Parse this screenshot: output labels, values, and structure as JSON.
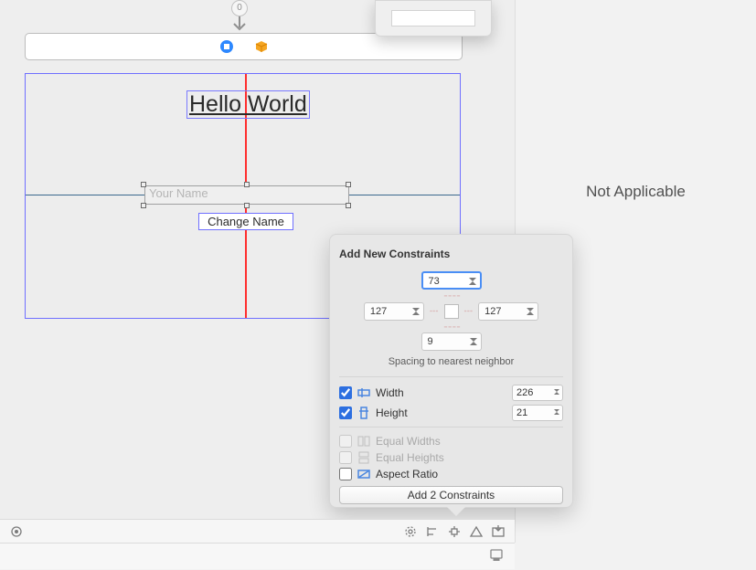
{
  "scene": {
    "label_text": "Hello World",
    "textfield_placeholder": "Your Name",
    "button_label": "Change Name"
  },
  "segue_badge": "0",
  "inspector_placeholder": "Not Applicable",
  "popover": {
    "title": "Add New Constraints",
    "top": "73",
    "leading": "127",
    "trailing": "127",
    "bottom": "9",
    "caption": "Spacing to nearest neighbor",
    "width_label": "Width",
    "width_value": "226",
    "height_label": "Height",
    "height_value": "21",
    "equal_widths": "Equal Widths",
    "equal_heights": "Equal Heights",
    "aspect_ratio": "Aspect Ratio",
    "submit": "Add 2 Constraints"
  }
}
